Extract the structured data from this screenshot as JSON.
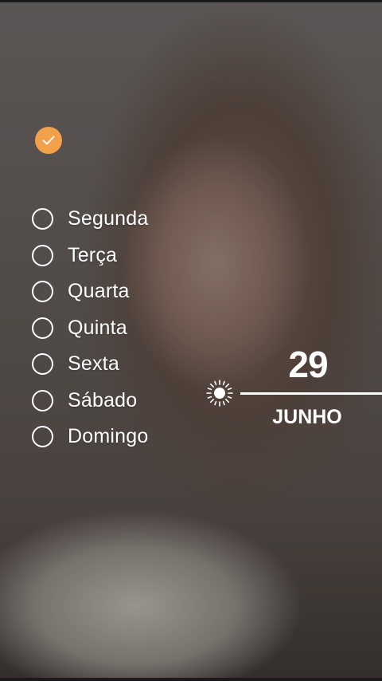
{
  "checklist": {
    "completed_icon": "check-icon",
    "accent_color": "#f2a14a",
    "days": [
      {
        "label": "Segunda",
        "checked": false
      },
      {
        "label": "Terça",
        "checked": false
      },
      {
        "label": "Quarta",
        "checked": false
      },
      {
        "label": "Quinta",
        "checked": false
      },
      {
        "label": "Sexta",
        "checked": false
      },
      {
        "label": "Sábado",
        "checked": false
      },
      {
        "label": "Domingo",
        "checked": false
      }
    ]
  },
  "date": {
    "day": "29",
    "month": "JUNHO",
    "icon": "sun-icon"
  }
}
